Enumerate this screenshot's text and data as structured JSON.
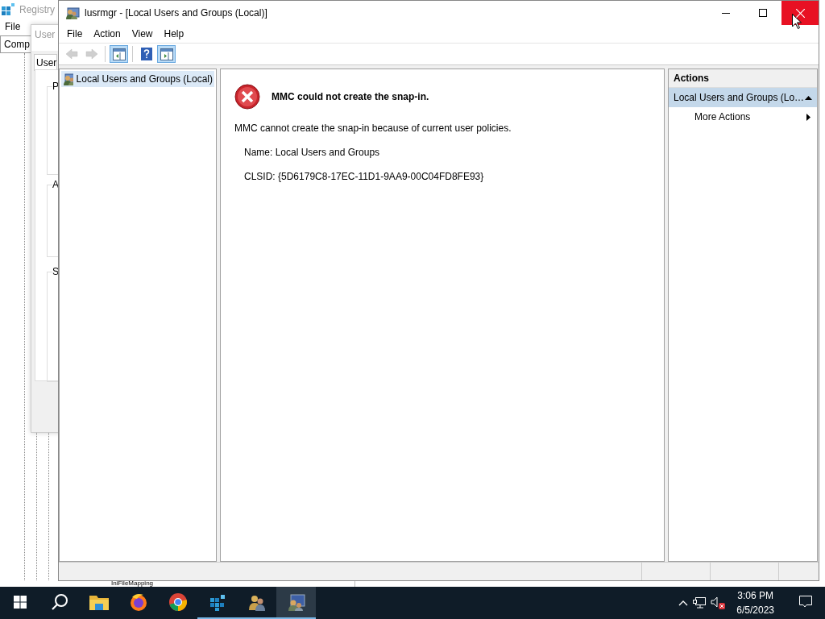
{
  "background_windows": {
    "registry": {
      "title": "Registry",
      "menu": [
        "File"
      ],
      "address": "Comp",
      "tree_item": "IniFileMapping"
    },
    "dialog": {
      "title": "User",
      "tab": "User",
      "groups": [
        "P",
        "A",
        "S"
      ]
    }
  },
  "window": {
    "title": "lusrmgr - [Local Users and Groups (Local)]",
    "controls": [
      {
        "kind": "minimize",
        "hovered": false
      },
      {
        "kind": "maximize",
        "hovered": false
      },
      {
        "kind": "close",
        "hovered": true
      }
    ],
    "menu": [
      "File",
      "Action",
      "View",
      "Help"
    ],
    "toolbar": [
      {
        "kind": "back",
        "disabled": true,
        "pressed": false
      },
      {
        "kind": "forward",
        "disabled": true,
        "pressed": false
      },
      {
        "kind": "separator"
      },
      {
        "kind": "console-tree",
        "disabled": false,
        "pressed": true
      },
      {
        "kind": "separator"
      },
      {
        "kind": "help",
        "disabled": false,
        "pressed": false
      },
      {
        "kind": "action-pane",
        "disabled": false,
        "pressed": true
      }
    ],
    "tree": [
      {
        "label": "Local Users and Groups (Local)",
        "selected": true
      }
    ],
    "error": {
      "heading": "MMC could not create the snap-in.",
      "message": "MMC cannot create the snap-in because of current user policies.",
      "details": [
        "Name: Local Users and Groups",
        "CLSID: {5D6179C8-17EC-11D1-9AA9-00C04FD8FE93}"
      ]
    },
    "actions": {
      "title": "Actions",
      "sections": [
        {
          "label": "Local Users and Groups (Lo…",
          "expanded": true,
          "items": [
            {
              "label": "More Actions"
            }
          ]
        }
      ]
    }
  },
  "taskbar": {
    "apps": [
      {
        "kind": "explorer",
        "running": false,
        "active": false
      },
      {
        "kind": "firefox",
        "running": false,
        "active": false
      },
      {
        "kind": "chrome",
        "running": false,
        "active": false
      },
      {
        "kind": "registry",
        "running": true,
        "active": false
      },
      {
        "kind": "users",
        "running": true,
        "active": false
      },
      {
        "kind": "mmc",
        "running": true,
        "active": true
      }
    ],
    "clock": {
      "time": "3:06 PM",
      "date": "6/5/2023"
    }
  }
}
